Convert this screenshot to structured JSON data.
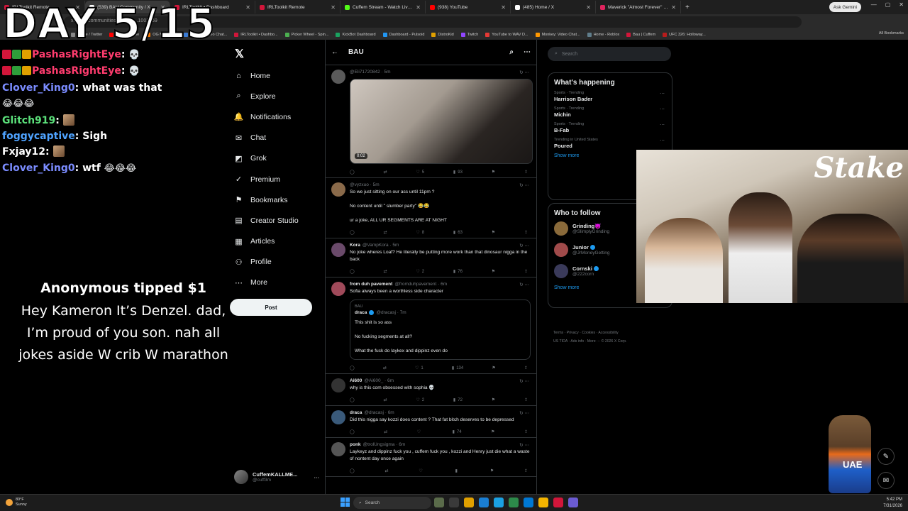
{
  "browser": {
    "tabs": [
      {
        "title": "IRLToolkit Remote",
        "color": "#d2163a",
        "active": false
      },
      {
        "title": "(539) BAU Community / X",
        "color": "#ffffff",
        "active": true
      },
      {
        "title": "IRLToolkit • Dashboard",
        "color": "#d2163a",
        "active": false
      },
      {
        "title": "IRLToolkit Remote",
        "color": "#d2163a",
        "active": false
      },
      {
        "title": "Cuffem Stream - Watch Live on",
        "color": "#53fc18",
        "active": false
      },
      {
        "title": "(938) YouTube",
        "color": "#ff0000",
        "active": false
      },
      {
        "title": "(485) Home / X",
        "color": "#ffffff",
        "active": false
      },
      {
        "title": "Maverick \"Almost Forever\" EP",
        "color": "#e0245e",
        "active": false
      }
    ],
    "new_tab": "+",
    "ask_gemini": "Ask Gemini",
    "url": "x.com/i/communities/190867...1002169",
    "bookmarks": [
      "Home / Twitter",
      "(57) YouTube",
      "OG MONKEY",
      "OmeTV Video Chat...",
      "IRLToolkit • Dashbo...",
      "Picker Wheel - Spin...",
      "KickBot Dashboard",
      "Dashboard - Pulsoid",
      "DistroKid",
      "Twitch",
      "YouTube to WAV D...",
      "Monkey: Video Chat...",
      "Home - Roblox",
      "Bau | Cuffem",
      "UFC 326: Holloway..."
    ],
    "all_bookmarks": "All Bookmarks"
  },
  "overlay": {
    "day_counter": "DAY 5/15",
    "chat": [
      {
        "user": "PashasRightEye",
        "color": "#ff3c6e",
        "badges": true,
        "text": "",
        "emoji": "💀"
      },
      {
        "user": "PashasRightEye",
        "color": "#ff3c6e",
        "badges": true,
        "text": "",
        "emoji": "💀"
      },
      {
        "user": "Clover_King0",
        "color": "#7b8cff",
        "badges": false,
        "text": "what was that",
        "emoji": ""
      },
      {
        "user": "",
        "color": "#ffffff",
        "badges": false,
        "text": "",
        "emoji": "😂😂😂"
      },
      {
        "user": "Glitch919",
        "color": "#5be07a",
        "badges": false,
        "text": "",
        "emoji": ""
      },
      {
        "user": "foggycaptive",
        "color": "#4fa3ff",
        "badges": false,
        "text": "Sigh",
        "emoji": ""
      },
      {
        "user": "Fxjay12",
        "color": "#ffffff",
        "badges": false,
        "text": "",
        "emoji": ""
      },
      {
        "user": "Clover_King0",
        "color": "#7b8cff",
        "badges": false,
        "text": "wtf",
        "emoji": "😂😂😂"
      }
    ],
    "tip_title": "Anonymous tipped $1",
    "tip_message": "Hey Kameron It’s Denzel. dad, I’m proud of you son. nah all jokes aside W crib W marathon"
  },
  "x_nav": {
    "logo": "𝕏",
    "items": [
      {
        "label": "Home",
        "icon": "⌂"
      },
      {
        "label": "Explore",
        "icon": "⌕"
      },
      {
        "label": "Notifications",
        "icon": "🔔"
      },
      {
        "label": "Chat",
        "icon": "✉"
      },
      {
        "label": "Grok",
        "icon": "◩"
      },
      {
        "label": "Premium",
        "icon": "✓"
      },
      {
        "label": "Bookmarks",
        "icon": "⚑"
      },
      {
        "label": "Creator Studio",
        "icon": "▤"
      },
      {
        "label": "Articles",
        "icon": "▦"
      },
      {
        "label": "Profile",
        "icon": "⚇"
      },
      {
        "label": "More",
        "icon": "⋯"
      }
    ],
    "post_label": "Post",
    "account_name": "CuffemKALLME...",
    "account_handle": "@cuff3m"
  },
  "timeline": {
    "back": "←",
    "title": "BAU",
    "tweets": [
      {
        "name": "",
        "handle": "@Eli71720842 · 5m",
        "text": [],
        "has_media": true,
        "media_time": "0:02",
        "replies": "",
        "likes": "5",
        "views": "93"
      },
      {
        "name": "",
        "handle": "@vyzxuo · 5m",
        "text": [
          "So we just sitting on our ass until 11pm ?",
          "No content until \" slumber party\" 😂😂",
          "ur a joke, ALL UR SEGMENTS ARE AT NIGHT"
        ],
        "has_media": false,
        "replies": "",
        "likes": "8",
        "views": "63"
      },
      {
        "name": "Kora",
        "handle": "@VampKora · 5m",
        "text": [
          "No joke wheres Loaf? He literally be putting more work than that dinosaur nigga in the back"
        ],
        "has_media": false,
        "replies": "",
        "likes": "2",
        "views": "76"
      },
      {
        "name": "from duh pavement",
        "handle": "@fromduhpavement · 6m",
        "text": [
          "Sofia always been a worthless side character"
        ],
        "has_media": false,
        "quote": {
          "context": "BAU",
          "name": "draca",
          "handle": "@dracasj · 7m",
          "text": [
            "This shit is so ass",
            "No fucking segments at all?",
            "What the fuck do laykex and dippinz even do"
          ]
        },
        "replies": "",
        "likes": "1",
        "views": "134"
      },
      {
        "name": "Ai600",
        "handle": "@Ai600_ · 6m",
        "text": [
          "why is this com obsessed with sophia 💀"
        ],
        "has_media": false,
        "replies": "",
        "likes": "2",
        "views": "72"
      },
      {
        "name": "draca",
        "handle": "@dracasj · 6m",
        "text": [
          "Did this nigga say kozzi does content ? That fat bitch deserves to be depressed"
        ],
        "has_media": false,
        "replies": "",
        "likes": "",
        "views": "74"
      },
      {
        "name": "ponk",
        "handle": "@trolUngsigma · 6m",
        "text": [
          "Laykeyz and dippinz fuck you , cuffem fuck you , kozzi and Henry just die what a waste of nontent day once again"
        ],
        "has_media": false,
        "replies": "",
        "likes": "",
        "views": ""
      }
    ]
  },
  "right": {
    "search_placeholder": "Search",
    "happening_title": "What's happening",
    "trends": [
      {
        "category": "Sports · Trending",
        "name": "Harrison Bader"
      },
      {
        "category": "Sports · Trending",
        "name": "Michin"
      },
      {
        "category": "Sports · Trending",
        "name": "B-Fab"
      },
      {
        "category": "Trending in United States",
        "name": "Poured"
      }
    ],
    "show_more": "Show more",
    "follow_title": "Who to follow",
    "follow": [
      {
        "name": "Grinding😈",
        "handle": "@SlimplyGrinding"
      },
      {
        "name": "Junior",
        "handle": "@JrMoneyGetting"
      },
      {
        "name": "Cornski",
        "handle": "@222corn"
      }
    ],
    "footer_line1": "Terms · Privacy · Cookies · Accessibility",
    "footer_line2": "US TIDA · Ads info · More ··· © 2026 X Corp."
  },
  "cam": {
    "logo": "Stake"
  },
  "mascot_text": "UAE",
  "taskbar": {
    "temp": "80°F",
    "condition": "Sunny",
    "search": "Search",
    "time": "5:42 PM",
    "date": "7/31/2026"
  }
}
